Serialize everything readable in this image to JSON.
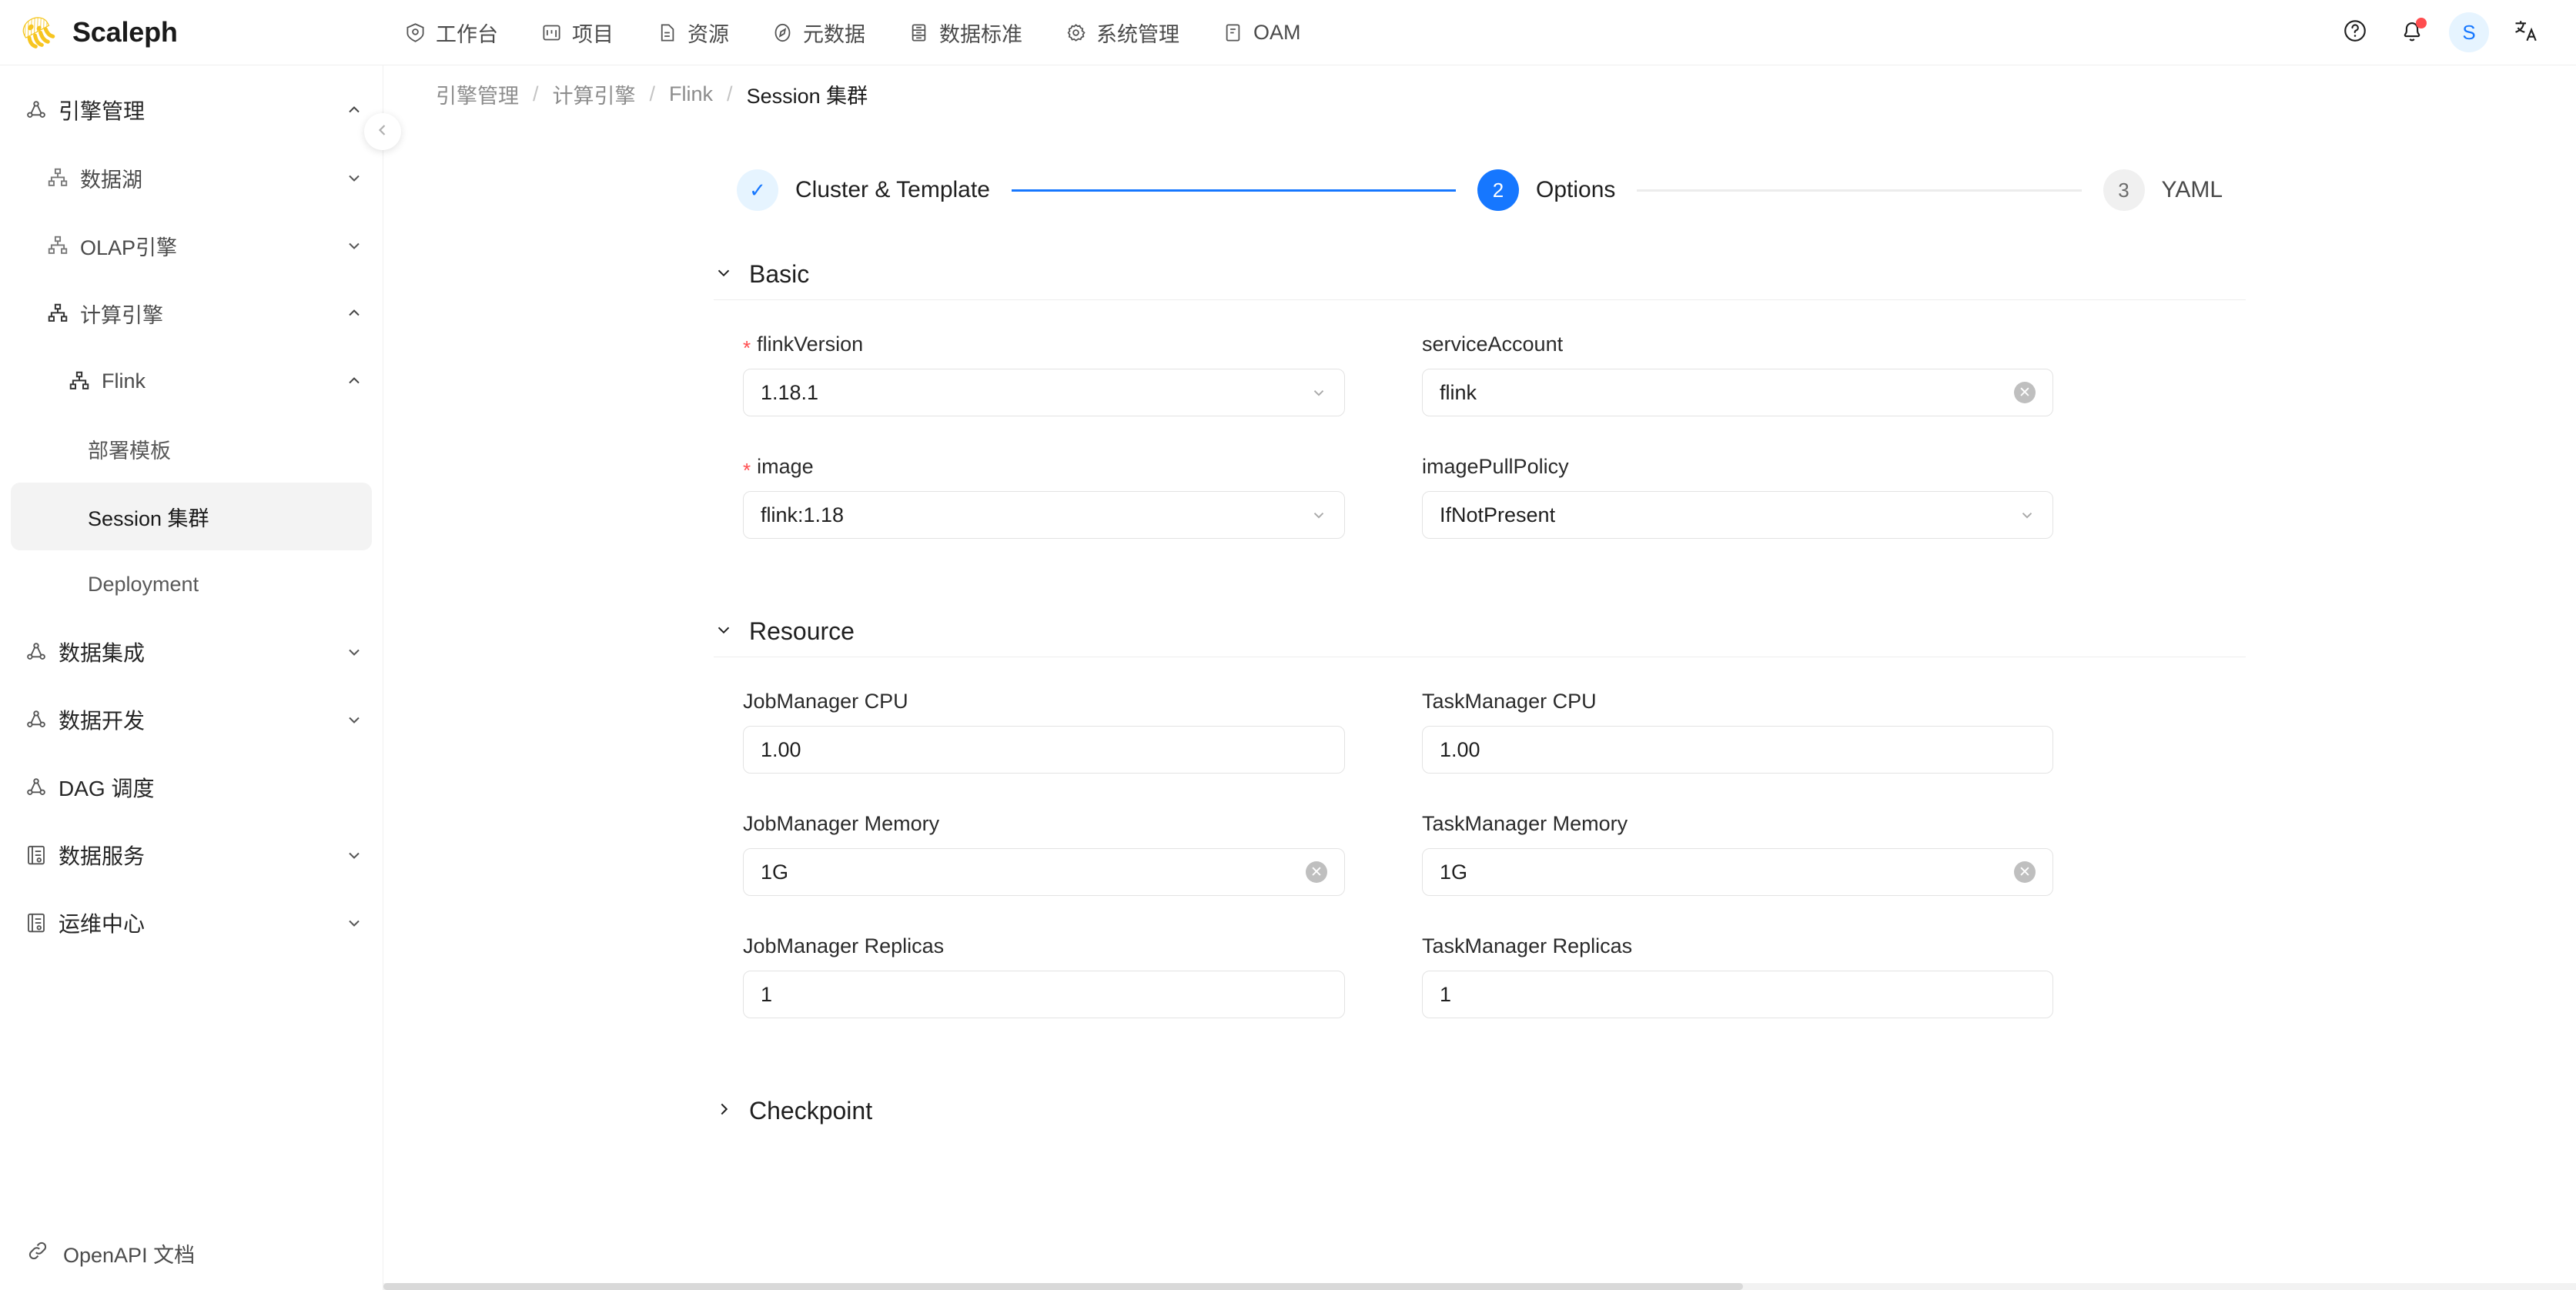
{
  "brand": {
    "name": "Scaleph",
    "logo_icon": "jellyfish-logo"
  },
  "topnav": {
    "items": [
      {
        "label": "工作台",
        "icon": "dashboard-icon"
      },
      {
        "label": "项目",
        "icon": "project-icon"
      },
      {
        "label": "资源",
        "icon": "resource-file-icon"
      },
      {
        "label": "元数据",
        "icon": "compass-metadata-icon"
      },
      {
        "label": "数据标准",
        "icon": "database-standard-icon"
      },
      {
        "label": "系统管理",
        "icon": "gear-icon"
      },
      {
        "label": "OAM",
        "icon": "oam-panel-icon"
      }
    ]
  },
  "topright": {
    "help_icon": "question-circle-icon",
    "notification_icon": "bell-icon",
    "notification_has_unread": true,
    "avatar_initial": "S",
    "avatar_bg": "#e6f4ff",
    "avatar_color": "#1677ff",
    "language_icon": "translate-icon"
  },
  "sidebar": {
    "collapse_icon": "chevron-left-icon",
    "items": [
      {
        "label": "引擎管理",
        "level": 0,
        "icon": "nodes-icon",
        "arrow": "chevron-up-icon",
        "selected": false
      },
      {
        "label": "数据湖",
        "level": 1,
        "icon": "cluster-icon",
        "arrow": "chevron-down-icon",
        "selected": false
      },
      {
        "label": "OLAP引擎",
        "level": 1,
        "icon": "cluster-icon",
        "arrow": "chevron-down-icon",
        "selected": false
      },
      {
        "label": "计算引擎",
        "level": 1,
        "icon": "cluster-icon",
        "arrow": "chevron-up-icon",
        "selected": false
      },
      {
        "label": "Flink",
        "level": 2,
        "icon": "cluster-icon",
        "arrow": "chevron-up-icon",
        "selected": false
      },
      {
        "label": "部署模板",
        "level": 3,
        "icon": "",
        "arrow": "",
        "selected": false
      },
      {
        "label": "Session 集群",
        "level": 3,
        "icon": "",
        "arrow": "",
        "selected": true
      },
      {
        "label": "Deployment",
        "level": 3,
        "icon": "",
        "arrow": "",
        "selected": false
      },
      {
        "label": "数据集成",
        "level": 0,
        "icon": "nodes-icon",
        "arrow": "chevron-down-icon",
        "selected": false
      },
      {
        "label": "数据开发",
        "level": 0,
        "icon": "nodes-icon",
        "arrow": "chevron-down-icon",
        "selected": false
      },
      {
        "label": "DAG 调度",
        "level": 0,
        "icon": "nodes-icon",
        "arrow": "",
        "selected": false
      },
      {
        "label": "数据服务",
        "level": 0,
        "icon": "api-service-icon",
        "arrow": "chevron-down-icon",
        "selected": false
      },
      {
        "label": "运维中心",
        "level": 0,
        "icon": "api-service-icon",
        "arrow": "chevron-down-icon",
        "selected": false
      }
    ],
    "footer": {
      "label": "OpenAPI 文档",
      "icon": "link-icon"
    }
  },
  "breadcrumb": {
    "items": [
      "引擎管理",
      "计算引擎",
      "Flink",
      "Session 集群"
    ],
    "separator": "/"
  },
  "stepper": {
    "steps": [
      {
        "index": "1",
        "label": "Cluster & Template",
        "state": "done",
        "marker": "✓"
      },
      {
        "index": "2",
        "label": "Options",
        "state": "active",
        "marker": "2"
      },
      {
        "index": "3",
        "label": "YAML",
        "state": "todo",
        "marker": "3"
      }
    ],
    "accent_color": "#1677ff",
    "inactive_color": "#f0f0f0"
  },
  "form": {
    "sections": [
      {
        "title": "Basic",
        "collapsed": false,
        "toggle_icon": "chevron-down-icon",
        "fields": [
          {
            "label": "flinkVersion",
            "required": true,
            "value": "1.18.1",
            "control": "select",
            "suffix": "chevron-down-icon"
          },
          {
            "label": "serviceAccount",
            "required": false,
            "value": "flink",
            "control": "input",
            "suffix": "clear-icon"
          },
          {
            "label": "image",
            "required": true,
            "value": "flink:1.18",
            "control": "select",
            "suffix": "chevron-down-icon"
          },
          {
            "label": "imagePullPolicy",
            "required": false,
            "value": "IfNotPresent",
            "control": "select",
            "suffix": "chevron-down-icon"
          }
        ]
      },
      {
        "title": "Resource",
        "collapsed": false,
        "toggle_icon": "chevron-down-icon",
        "fields": [
          {
            "label": "JobManager CPU",
            "required": false,
            "value": "1.00",
            "control": "input",
            "suffix": ""
          },
          {
            "label": "TaskManager CPU",
            "required": false,
            "value": "1.00",
            "control": "input",
            "suffix": ""
          },
          {
            "label": "JobManager Memory",
            "required": false,
            "value": "1G",
            "control": "input",
            "suffix": "clear-icon"
          },
          {
            "label": "TaskManager Memory",
            "required": false,
            "value": "1G",
            "control": "input",
            "suffix": "clear-icon"
          },
          {
            "label": "JobManager Replicas",
            "required": false,
            "value": "1",
            "control": "input",
            "suffix": ""
          },
          {
            "label": "TaskManager Replicas",
            "required": false,
            "value": "1",
            "control": "input",
            "suffix": ""
          }
        ]
      },
      {
        "title": "Checkpoint",
        "collapsed": true,
        "toggle_icon": "chevron-right-icon",
        "fields": []
      }
    ]
  }
}
